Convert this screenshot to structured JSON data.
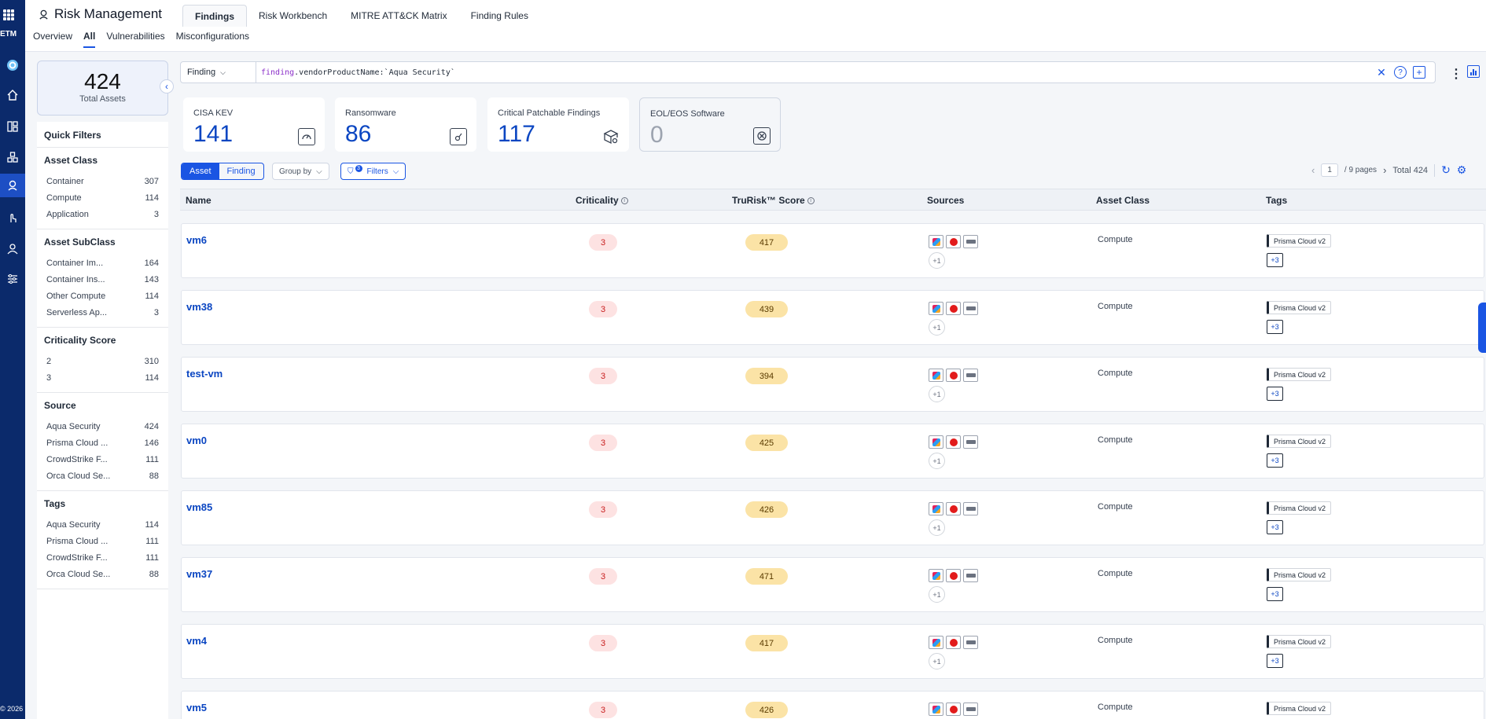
{
  "rail": {
    "product": "ETM",
    "copyright": "© 2026"
  },
  "header": {
    "title": "Risk Management",
    "tabs": [
      {
        "label": "Findings",
        "active": true
      },
      {
        "label": "Risk Workbench",
        "active": false
      },
      {
        "label": "MITRE ATT&CK Matrix",
        "active": false
      },
      {
        "label": "Finding Rules",
        "active": false
      }
    ],
    "subtabs": [
      {
        "label": "Overview",
        "active": false
      },
      {
        "label": "All",
        "active": true
      },
      {
        "label": "Vulnerabilities",
        "active": false
      },
      {
        "label": "Misconfigurations",
        "active": false
      }
    ]
  },
  "total_assets": {
    "value": "424",
    "label": "Total Assets"
  },
  "filters": {
    "title": "Quick Filters",
    "groups": [
      {
        "title": "Asset Class",
        "items": [
          {
            "label": "Container",
            "count": "307"
          },
          {
            "label": "Compute",
            "count": "114"
          },
          {
            "label": "Application",
            "count": "3"
          }
        ]
      },
      {
        "title": "Asset SubClass",
        "items": [
          {
            "label": "Container Im...",
            "count": "164"
          },
          {
            "label": "Container Ins...",
            "count": "143"
          },
          {
            "label": "Other Compute",
            "count": "114"
          },
          {
            "label": "Serverless Ap...",
            "count": "3"
          }
        ]
      },
      {
        "title": "Criticality Score",
        "items": [
          {
            "label": "2",
            "count": "310"
          },
          {
            "label": "3",
            "count": "114"
          }
        ]
      },
      {
        "title": "Source",
        "items": [
          {
            "label": "Aqua Security",
            "count": "424"
          },
          {
            "label": "Prisma Cloud ...",
            "count": "146"
          },
          {
            "label": "CrowdStrike F...",
            "count": "111"
          },
          {
            "label": "Orca Cloud Se...",
            "count": "88"
          }
        ]
      },
      {
        "title": "Tags",
        "items": [
          {
            "label": "Aqua Security",
            "count": "114"
          },
          {
            "label": "Prisma Cloud ...",
            "count": "111"
          },
          {
            "label": "CrowdStrike F...",
            "count": "111"
          },
          {
            "label": "Orca Cloud Se...",
            "count": "88"
          }
        ]
      }
    ]
  },
  "search": {
    "scope": "Finding",
    "query_keyword": "finding",
    "query_rest": ".vendorProductName:`Aqua Security`"
  },
  "stats": [
    {
      "label": "CISA KEV",
      "value": "141",
      "icon": "gauge-icon"
    },
    {
      "label": "Ransomware",
      "value": "86",
      "icon": "ransomware-icon"
    },
    {
      "label": "Critical Patchable Findings",
      "value": "117",
      "icon": "patch-box-icon"
    },
    {
      "label": "EOL/EOS Software",
      "value": "0",
      "icon": "eol-icon"
    }
  ],
  "toolbar": {
    "view_asset": "Asset",
    "view_finding": "Finding",
    "group_by": "Group by",
    "filters": "Filters",
    "filters_count": "3",
    "page": "1",
    "pages": "/   9 pages",
    "total": "Total 424"
  },
  "table": {
    "headers": {
      "name": "Name",
      "criticality": "Criticality",
      "score": "TruRisk™ Score",
      "sources": "Sources",
      "asset_class": "Asset Class",
      "tags": "Tags"
    },
    "more_sources": "+1",
    "tag": "Prisma Cloud v2",
    "more_tags": "+3",
    "rows": [
      {
        "name": "vm6",
        "criticality": "3",
        "score": "417",
        "asset_class": "Compute"
      },
      {
        "name": "vm38",
        "criticality": "3",
        "score": "439",
        "asset_class": "Compute"
      },
      {
        "name": "test-vm",
        "criticality": "3",
        "score": "394",
        "asset_class": "Compute"
      },
      {
        "name": "vm0",
        "criticality": "3",
        "score": "425",
        "asset_class": "Compute"
      },
      {
        "name": "vm85",
        "criticality": "3",
        "score": "426",
        "asset_class": "Compute"
      },
      {
        "name": "vm37",
        "criticality": "3",
        "score": "471",
        "asset_class": "Compute"
      },
      {
        "name": "vm4",
        "criticality": "3",
        "score": "417",
        "asset_class": "Compute"
      },
      {
        "name": "vm5",
        "criticality": "3",
        "score": "426",
        "asset_class": "Compute"
      }
    ]
  },
  "colors": {
    "rail": "#0b2a6b",
    "accent": "#1a55e3",
    "link": "#0b46c2",
    "criticality_bg": "#fde2e2",
    "score_bg": "#fbe3a6"
  }
}
